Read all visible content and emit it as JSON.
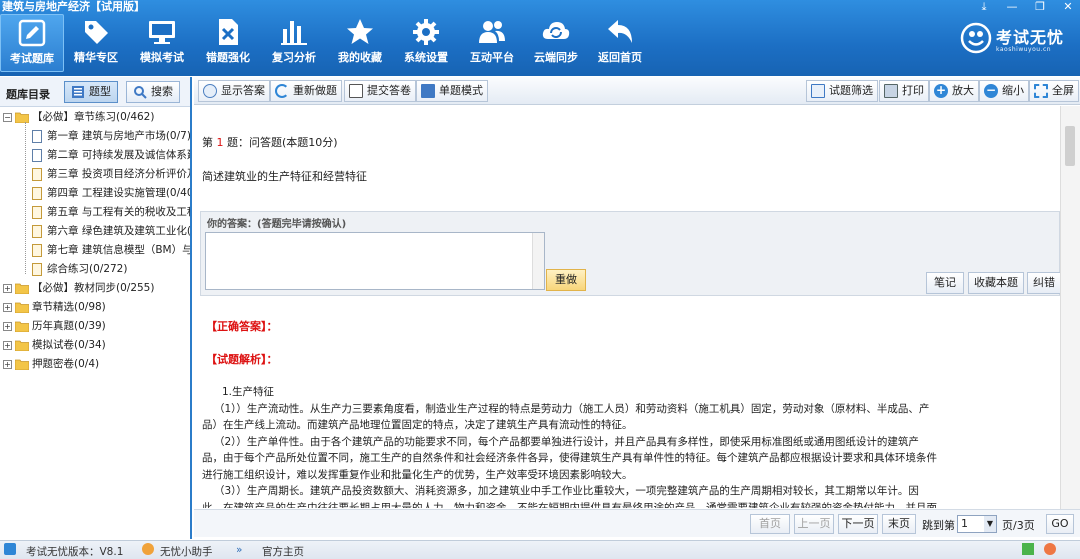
{
  "window": {
    "title": "建筑与房地产经济【试用版】",
    "controls": [
      "⤓",
      "—",
      "❐",
      "✕"
    ]
  },
  "toolbar": [
    {
      "label": "考试题库",
      "icon": "pencil-icon",
      "active": true
    },
    {
      "label": "精华专区",
      "icon": "tag-icon"
    },
    {
      "label": "模拟考试",
      "icon": "monitor-icon"
    },
    {
      "label": "错题强化",
      "icon": "error-doc-icon"
    },
    {
      "label": "复习分析",
      "icon": "bar-chart-icon"
    },
    {
      "label": "我的收藏",
      "icon": "star-icon"
    },
    {
      "label": "系统设置",
      "icon": "gear-icon"
    },
    {
      "label": "互动平台",
      "icon": "users-icon"
    },
    {
      "label": "云端同步",
      "icon": "cloud-sync-icon"
    },
    {
      "label": "返回首页",
      "icon": "back-arrow-icon"
    }
  ],
  "brand": {
    "name": "考试无忧",
    "sub": "kaoshiwuyou.cn"
  },
  "sidebar": {
    "title": "题库目录",
    "tab_topic": "题型",
    "tab_search": "搜索",
    "tree": [
      {
        "label": "【必做】章节练习(0/462)",
        "level": 0,
        "kind": "folder",
        "expanded": true
      },
      {
        "label": "第一章  建筑与房地产市场(0/7)",
        "level": 1,
        "kind": "doc"
      },
      {
        "label": "第二章  可持续发展及诚信体系建设",
        "level": 1,
        "kind": "doc"
      },
      {
        "label": "第三章  投资项目经济分析评价及",
        "level": 1,
        "kind": "note"
      },
      {
        "label": "第四章  工程建设实施管理(0/40",
        "level": 1,
        "kind": "note"
      },
      {
        "label": "第五章  与工程有关的税收及工程",
        "level": 1,
        "kind": "note"
      },
      {
        "label": "第六章  绿色建筑及建筑工业化(",
        "level": 1,
        "kind": "note"
      },
      {
        "label": "第七章  建筑信息模型（BM）与新",
        "level": 1,
        "kind": "note"
      },
      {
        "label": "综合练习(0/272)",
        "level": 1,
        "kind": "note"
      },
      {
        "label": "【必做】教材同步(0/255)",
        "level": 0,
        "kind": "folder"
      },
      {
        "label": "章节精选(0/98)",
        "level": 0,
        "kind": "folder"
      },
      {
        "label": "历年真题(0/39)",
        "level": 0,
        "kind": "folder"
      },
      {
        "label": "模拟试卷(0/34)",
        "level": 0,
        "kind": "folder"
      },
      {
        "label": "押题密卷(0/4)",
        "level": 0,
        "kind": "folder"
      }
    ]
  },
  "content_toolbar": {
    "show_answer": "显示答案",
    "redo_all": "重新做题",
    "submit": "提交答卷",
    "single_mode": "单题模式",
    "filter": "试题筛选",
    "print": "打印",
    "zoom_in": "放大",
    "zoom_out": "缩小",
    "fullscreen": "全屏"
  },
  "question": {
    "prefix": "第",
    "number": "1",
    "suffix": "题：问答题(本题10分)",
    "text": "简述建筑业的生产特征和经营特征"
  },
  "answer": {
    "label": "你的答案：(答题完毕请按确认)",
    "value": "",
    "redo": "重做",
    "note": "笔记",
    "favorite": "收藏本题",
    "correct": "纠错"
  },
  "analysis": {
    "correct_heading": "【正确答案】：",
    "analysis_heading": "【试题解析】：",
    "lines": [
      "1.生产特征",
      "（1））生产流动性。从生产力三要素角度看，制造业生产过程的特点是劳动力（施工人员）和劳动资料（施工机具）固定，劳动对象（原材料、半成品、产",
      "品）在生产线上流动。而建筑产品地理位置固定的特点，决定了建筑生产具有流动性的特征。",
      "（2））生产单件性。由于各个建筑产品的功能要求不同，每个产品都要单独进行设计，并且产品具有多样性，即使采用标准图纸或通用图纸设计的建筑产",
      "品，由于每个产品所处位置不同，施工生产的自然条件和社会经济条件各异，使得建筑生产具有单件性的特征。每个建筑产品都应根据设计要求和具体环境条件",
      "进行施工组织设计，难以发挥重复作业和批量化生产的优势，生产效率受环境因素影响较大。",
      "（3））生产周期长。建筑产品投资数额大、消耗资源多，加之建筑业中手工作业比重较大，一项完整建筑产品的生产周期相对较长，其工期常以年计。因",
      "此，在建筑产品的生产中往往要长期占用大量的人力、物力和资金，不能在短期内提供具有最终用途的产品，通常需要建筑企业有较强的资金垫付能力，并且面"
    ]
  },
  "pager": {
    "first": "首页",
    "prev": "上一页",
    "next": "下一页",
    "last": "末页",
    "jump_label": "跳到第",
    "current": "1",
    "total": "页/3页",
    "go": "GO"
  },
  "statusbar": {
    "version": "考试无忧版本：V8.1",
    "assistant": "无忧小助手",
    "site": "官方主页"
  }
}
